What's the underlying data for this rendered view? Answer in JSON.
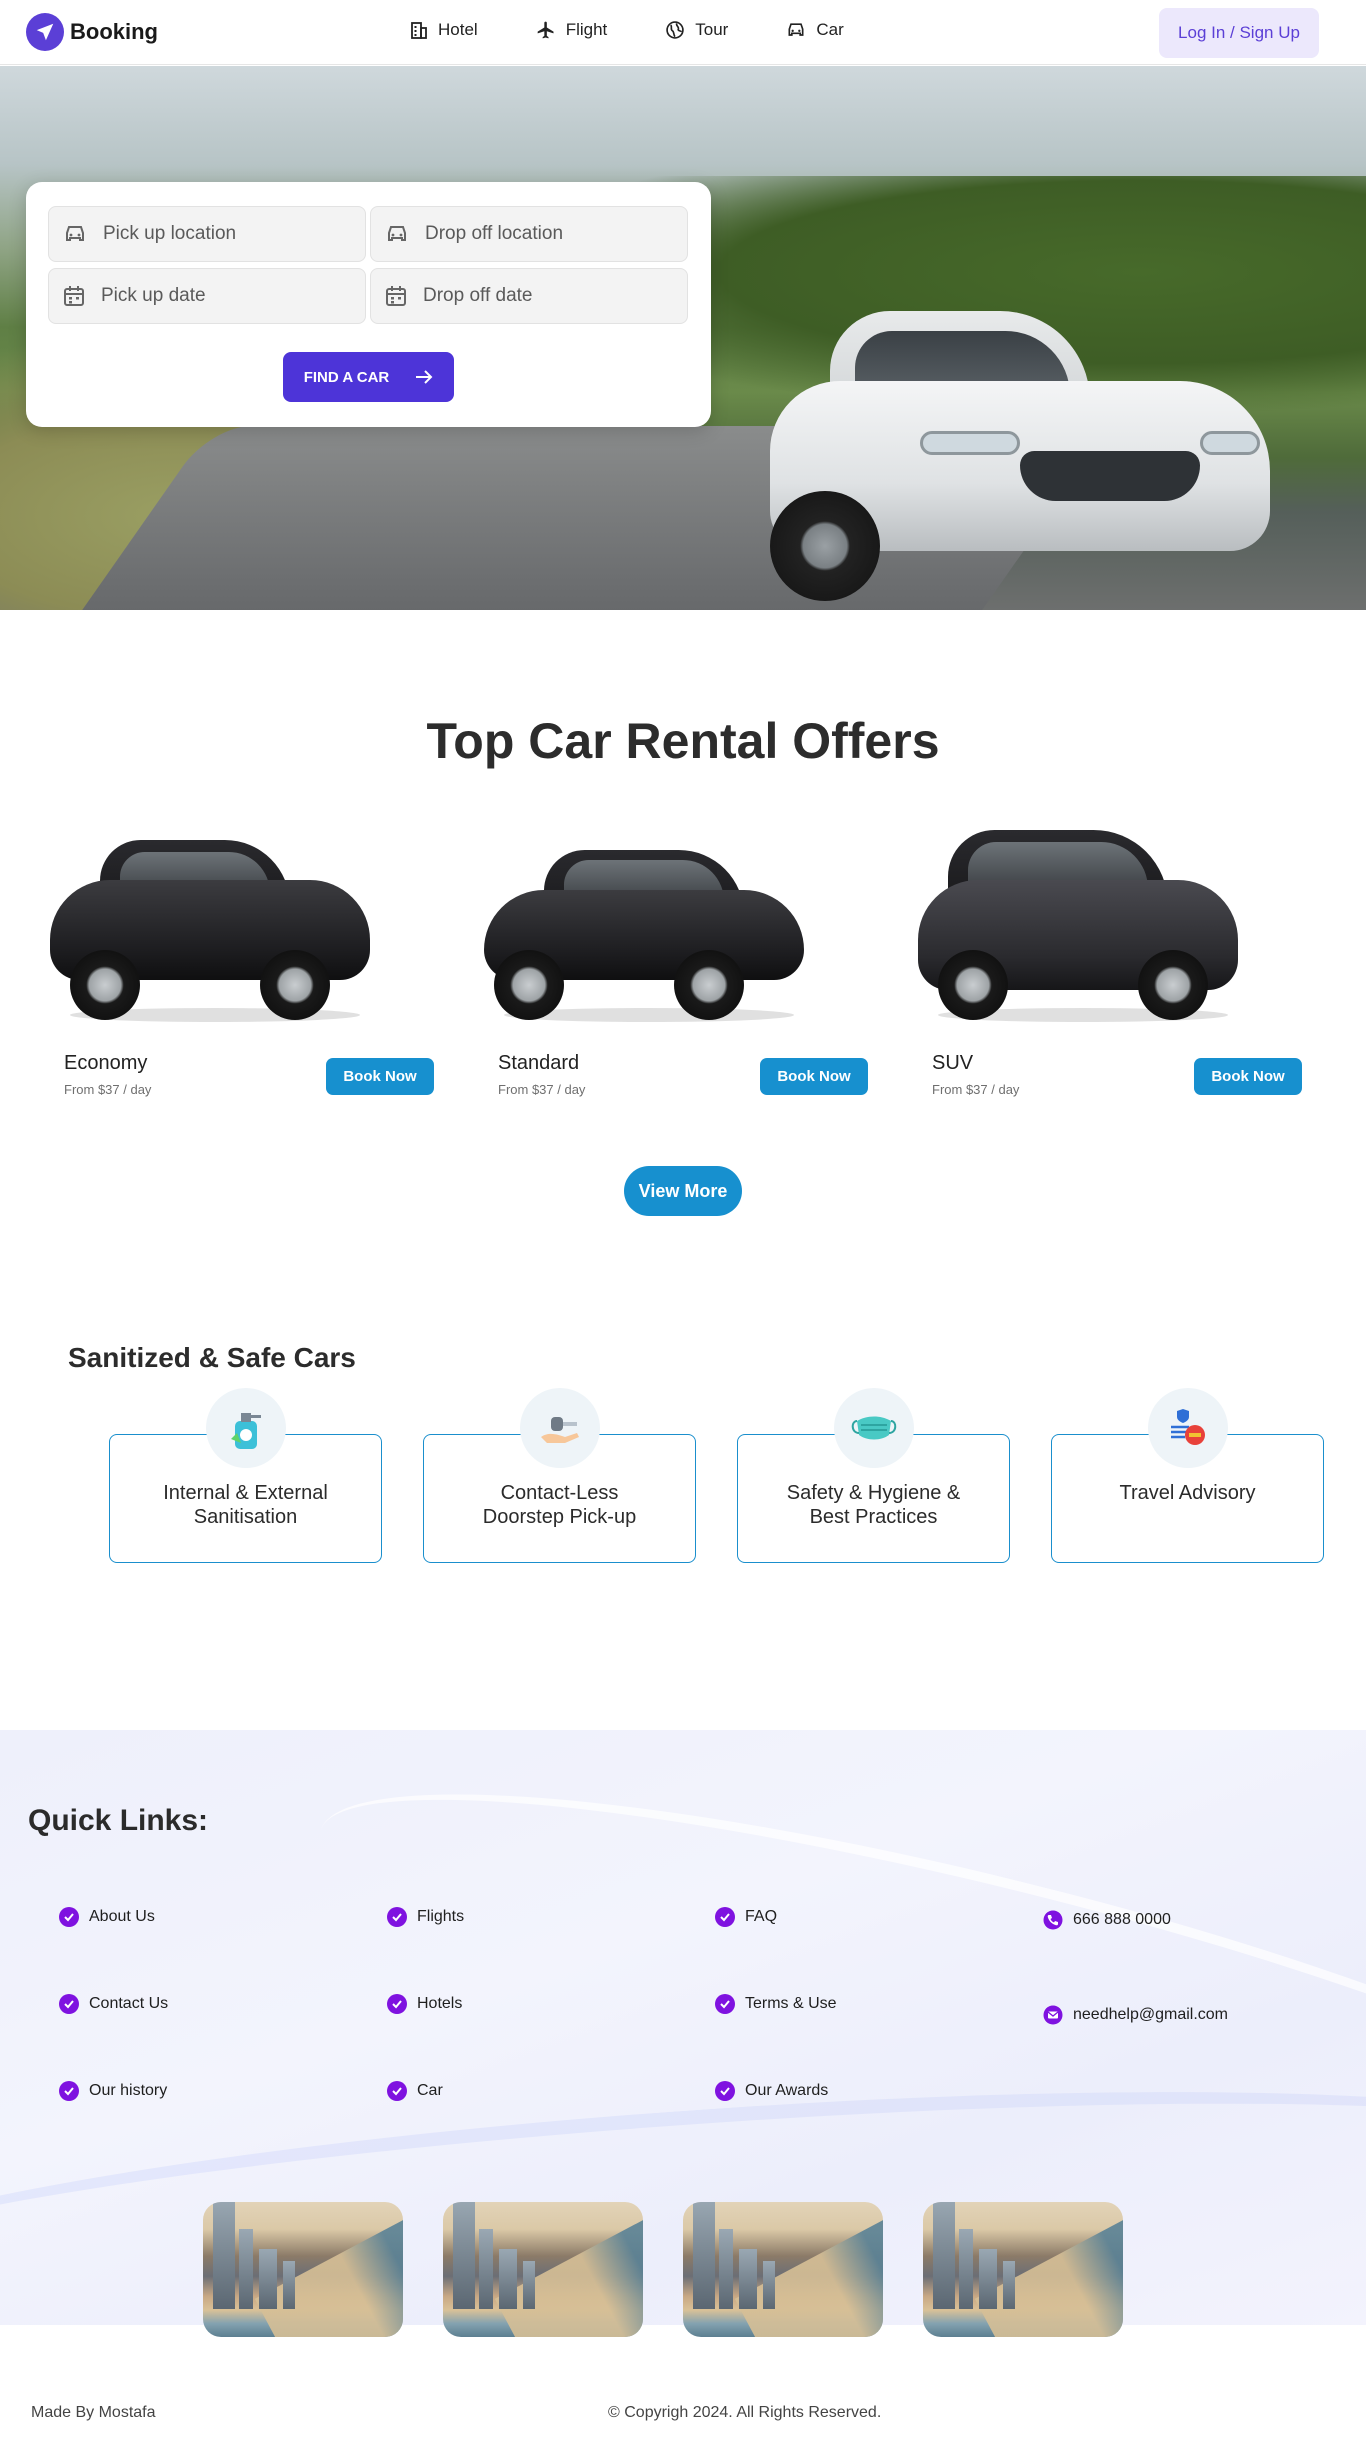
{
  "brand": {
    "name": "Booking",
    "logo_icon": "plane-icon"
  },
  "nav": {
    "items": [
      {
        "label": "Hotel",
        "icon": "building-icon"
      },
      {
        "label": "Flight",
        "icon": "plane-icon"
      },
      {
        "label": "Tour",
        "icon": "globe-icon"
      },
      {
        "label": "Car",
        "icon": "car-icon"
      }
    ],
    "login_label": "Log In / Sign Up"
  },
  "search": {
    "pickup_location_placeholder": "Pick up location",
    "dropoff_location_placeholder": "Drop off location",
    "pickup_date_placeholder": "Pick up date",
    "dropoff_date_placeholder": "Drop off date",
    "submit_label": "FIND A CAR"
  },
  "offers": {
    "title": "Top Car Rental Offers",
    "items": [
      {
        "name": "Economy",
        "price": "From $37 / day",
        "button": "Book Now"
      },
      {
        "name": "Standard",
        "price": "From $37 / day",
        "button": "Book Now"
      },
      {
        "name": "SUV",
        "price": "From $37 / day",
        "button": "Book Now"
      }
    ],
    "view_more": "View More"
  },
  "safe": {
    "title": "Sanitized & Safe Cars",
    "items": [
      {
        "line1": "Internal & External",
        "line2": "Sanitisation",
        "icon": "sanitizer-icon"
      },
      {
        "line1": "Contact-Less",
        "line2": "Doorstep Pick-up",
        "icon": "key-hand-icon"
      },
      {
        "line1": "Safety & Hygiene &",
        "line2": "Best Practices",
        "icon": "mask-icon"
      },
      {
        "line1": "Travel Advisory",
        "line2": "",
        "icon": "advisory-icon"
      }
    ]
  },
  "quick_links": {
    "title": "Quick Links:",
    "col1": [
      "About Us",
      "Contact Us",
      "Our history"
    ],
    "col2": [
      "Flights",
      "Hotels",
      "Car"
    ],
    "col3": [
      "FAQ",
      "Terms & Use",
      "Our Awards"
    ],
    "phone": "666 888 0000",
    "email": "needhelp@gmail.com"
  },
  "colors": {
    "accent": "#5b3fd6",
    "primary_blue": "#1790cf",
    "check_purple": "#7f12e0"
  },
  "footer": {
    "left": "Made By Mostafa",
    "center": "© Copyrigh 2024. All Rights Reserved."
  }
}
